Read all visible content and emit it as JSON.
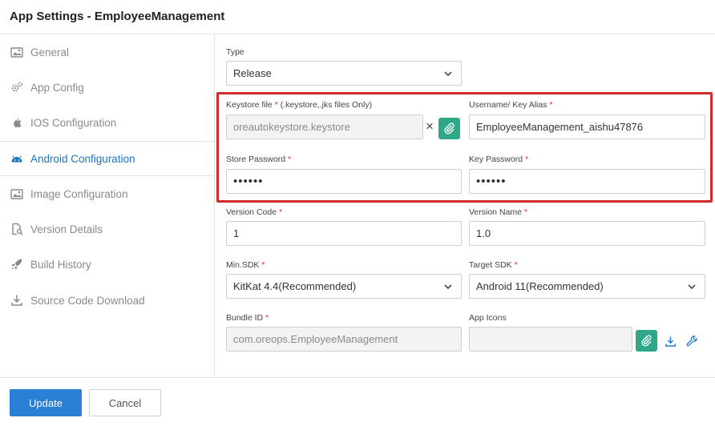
{
  "header": {
    "title": "App Settings - EmployeeManagement"
  },
  "sidebar": {
    "items": [
      {
        "label": "General",
        "icon": "image-icon"
      },
      {
        "label": "App Config",
        "icon": "gears-icon"
      },
      {
        "label": "IOS Configuration",
        "icon": "apple-icon"
      },
      {
        "label": "Android Configuration",
        "icon": "android-icon",
        "active": true
      },
      {
        "label": "Image Configuration",
        "icon": "image-icon"
      },
      {
        "label": "Version Details",
        "icon": "document-search-icon"
      },
      {
        "label": "Build History",
        "icon": "rocket-icon"
      },
      {
        "label": "Source Code Download",
        "icon": "download-icon"
      }
    ]
  },
  "form": {
    "type": {
      "label": "Type",
      "value": "Release"
    },
    "keystore": {
      "label": "Keystore file",
      "hint": "(.keystore,.jks files Only)",
      "value": "oreautokeystore.keystore",
      "clear": "×"
    },
    "alias": {
      "label": "Username/ Key Alias",
      "value": "EmployeeManagement_aishu47876"
    },
    "store_password": {
      "label": "Store Password",
      "value": "••••••"
    },
    "key_password": {
      "label": "Key Password",
      "value": "••••••"
    },
    "version_code": {
      "label": "Version Code",
      "value": "1"
    },
    "version_name": {
      "label": "Version Name",
      "value": "1.0"
    },
    "min_sdk": {
      "label": "Min.SDK",
      "value": "KitKat 4.4(Recommended)"
    },
    "target_sdk": {
      "label": "Target SDK",
      "value": "Android 11(Recommended)"
    },
    "bundle_id": {
      "label": "Bundle ID",
      "value": "com.oreops.EmployeeManagement"
    },
    "app_icons": {
      "label": "App Icons",
      "value": ""
    },
    "required_mark": "*"
  },
  "footer": {
    "update_label": "Update",
    "cancel_label": "Cancel"
  },
  "colors": {
    "accent": "#2b7fd4",
    "attach": "#2ea889",
    "highlight": "#d02a2a",
    "required": "#d9302c"
  }
}
